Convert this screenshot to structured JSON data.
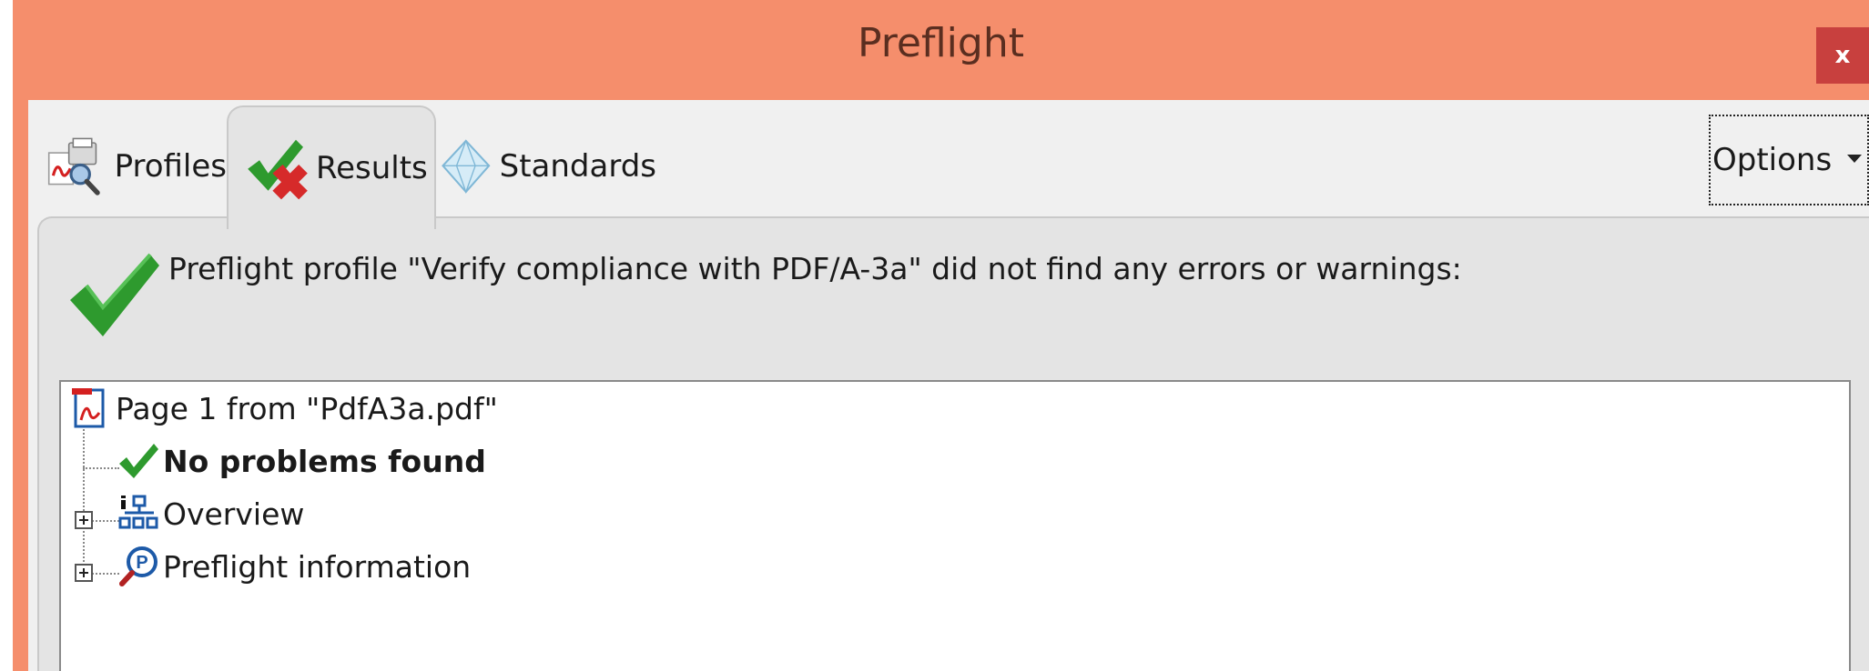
{
  "window": {
    "title": "Preflight",
    "close_label": "x"
  },
  "tabs": [
    {
      "label": "Profiles",
      "icon": "profiles-icon",
      "active": false
    },
    {
      "label": "Results",
      "icon": "results-icon",
      "active": true
    },
    {
      "label": "Standards",
      "icon": "standards-icon",
      "active": false
    }
  ],
  "options": {
    "label": "Options"
  },
  "result": {
    "message": "Preflight profile \"Verify compliance with PDF/A-3a\" did not find any errors or warnings:"
  },
  "tree": {
    "items": [
      {
        "label": "Page 1 from \"PdfA3a.pdf\"",
        "icon": "pdf-page-icon"
      },
      {
        "label": "No problems found",
        "icon": "checkmark-icon"
      },
      {
        "label": "Overview",
        "icon": "overview-icon"
      },
      {
        "label": "Preflight information",
        "icon": "preflight-info-icon"
      }
    ]
  },
  "colors": {
    "titlebar": "#f58e6c",
    "close_button": "#c8403e",
    "check_green": "#2e9a2e",
    "cross_red": "#d62a2a"
  }
}
